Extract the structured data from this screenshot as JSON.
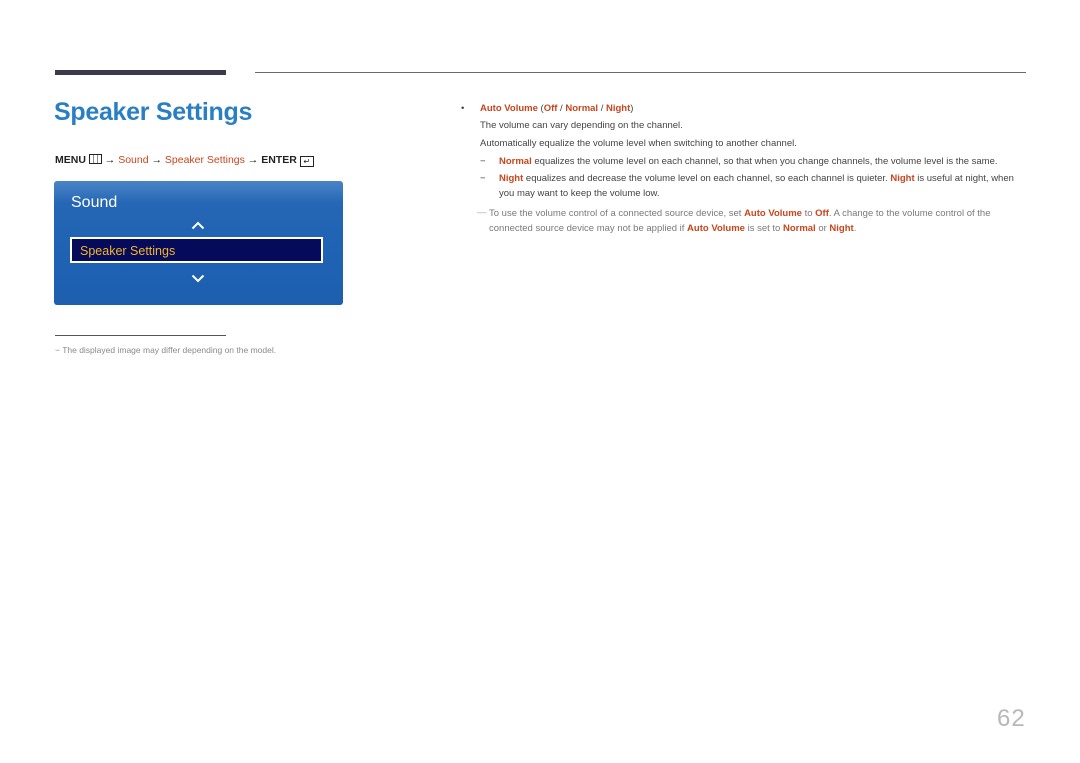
{
  "page_title": "Speaker Settings",
  "menu_path": {
    "menu_label": "MENU",
    "menu_icon": "menu-grid-icon",
    "arrow": "→",
    "sound": "Sound",
    "speaker_settings": "Speaker Settings",
    "enter_label": "ENTER",
    "enter_icon": "enter-icon"
  },
  "osd_panel": {
    "title": "Sound",
    "up_icon": "chevron-up-icon",
    "selected_item": "Speaker Settings",
    "down_icon": "chevron-down-icon"
  },
  "footnote": {
    "dash": "−",
    "text": "The displayed image may differ depending on the model."
  },
  "content": {
    "bullet": "•",
    "heading": {
      "name": "Auto Volume",
      "open": " (",
      "opt1": "Off",
      "sep1": " / ",
      "opt2": "Normal",
      "sep2": " / ",
      "opt3": "Night",
      "close": ")"
    },
    "line1": "The volume can vary depending on the channel.",
    "line2": "Automatically equalize the volume level when switching to another channel.",
    "items": [
      {
        "dash": "−",
        "term": "Normal",
        "text": " equalizes the volume level on each channel, so that when you change channels, the volume level is the same."
      },
      {
        "dash": "−",
        "term": "Night",
        "text": " equalizes and decrease the volume level on each channel, so each channel is quieter. ",
        "term2": "Night",
        "text2": " is useful at night, when you may want to keep the volume low."
      }
    ],
    "note": {
      "dash": "—",
      "t1": "To use the volume control of a connected source device, set ",
      "b1": "Auto Volume",
      "t2": " to ",
      "b2": "Off",
      "t3": ". A change to the volume control of the connected source device may not be applied if ",
      "b3": "Auto Volume",
      "t4": " is set to ",
      "b4": "Normal",
      "t5": " or ",
      "b5": "Night",
      "t6": "."
    }
  },
  "page_number": "62",
  "colors": {
    "title_blue": "#2a7fc4",
    "accent_orange": "#c9451c",
    "panel_blue": "#1f62b3",
    "selected_bg": "#050a5a",
    "selected_text": "#f2b52a"
  }
}
